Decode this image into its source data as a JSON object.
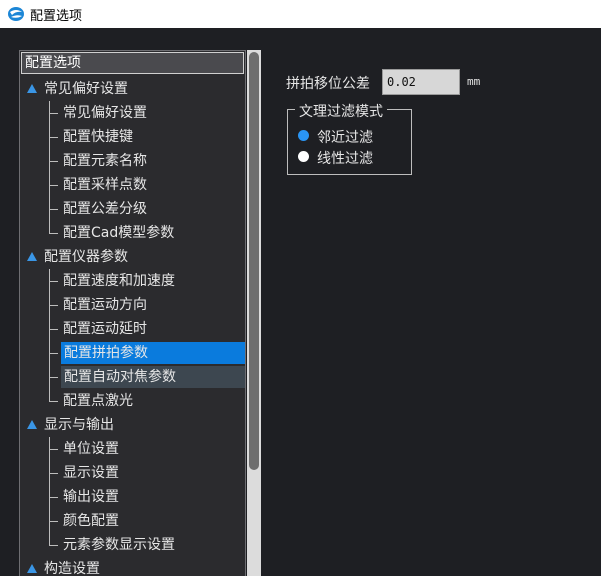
{
  "window": {
    "title": "配置选项",
    "icon": "app-logo-icon"
  },
  "tree": {
    "header": "配置选项",
    "nodes": [
      {
        "type": "group",
        "label": "常见偏好设置"
      },
      {
        "type": "child",
        "label": "常见偏好设置"
      },
      {
        "type": "child",
        "label": "配置快捷键"
      },
      {
        "type": "child",
        "label": "配置元素名称"
      },
      {
        "type": "child",
        "label": "配置采样点数"
      },
      {
        "type": "child",
        "label": "配置公差分级"
      },
      {
        "type": "child",
        "label": "配置Cad模型参数",
        "last": true
      },
      {
        "type": "group",
        "label": "配置仪器参数"
      },
      {
        "type": "child",
        "label": "配置速度和加速度"
      },
      {
        "type": "child",
        "label": "配置运动方向"
      },
      {
        "type": "child",
        "label": "配置运动延时"
      },
      {
        "type": "child",
        "label": "配置拼拍参数",
        "state": "selected"
      },
      {
        "type": "child",
        "label": "配置自动对焦参数",
        "state": "hover"
      },
      {
        "type": "child",
        "label": "配置点激光",
        "last": true
      },
      {
        "type": "group",
        "label": "显示与输出"
      },
      {
        "type": "child",
        "label": "单位设置"
      },
      {
        "type": "child",
        "label": "显示设置"
      },
      {
        "type": "child",
        "label": "输出设置"
      },
      {
        "type": "child",
        "label": "颜色配置"
      },
      {
        "type": "child",
        "label": "元素参数显示设置",
        "last": true
      },
      {
        "type": "group",
        "label": "构造设置"
      }
    ]
  },
  "panel": {
    "tolerance_label": "拼拍移位公差",
    "tolerance_value": "0.02",
    "tolerance_unit": "mm",
    "filter_group_title": "文理过滤模式",
    "filter_options": [
      {
        "label": "邻近过滤",
        "selected": true
      },
      {
        "label": "线性过滤",
        "selected": false
      }
    ]
  },
  "colors": {
    "accent": "#0a7bdd",
    "radio_on": "#2a95f4",
    "background": "#1e1f23"
  }
}
